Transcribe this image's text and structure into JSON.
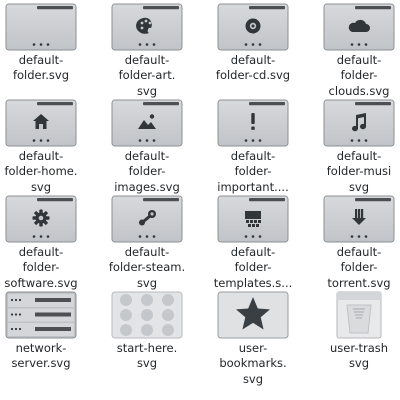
{
  "colors": {
    "folder_body": "#c3c6ca",
    "folder_border": "#8c8f93",
    "folder_tab": "#4d4f52",
    "folder_symbol": "#31363b",
    "folder_dots": "#31363b",
    "label_text": "#232629",
    "background": "#ffffff"
  },
  "files": [
    {
      "name": "default-folder.svg",
      "icon": "folder-plain-icon",
      "lines": [
        "default-",
        "folder.svg"
      ]
    },
    {
      "name": "default-folder-art.svg",
      "icon": "folder-art-icon",
      "lines": [
        "default-",
        "folder-art.",
        "svg"
      ]
    },
    {
      "name": "default-folder-cd.svg",
      "icon": "folder-cd-icon",
      "lines": [
        "default-",
        "folder-cd.svg"
      ]
    },
    {
      "name": "default-folder-clouds.svg",
      "icon": "folder-clouds-icon",
      "lines": [
        "default-",
        "folder-",
        "clouds.svg"
      ]
    },
    {
      "name": "default-folder-home.svg",
      "icon": "folder-home-icon",
      "lines": [
        "default-",
        "folder-home.",
        "svg"
      ]
    },
    {
      "name": "default-folder-images.svg",
      "icon": "folder-images-icon",
      "lines": [
        "default-",
        "folder-",
        "images.svg"
      ]
    },
    {
      "name": "default-folder-important....",
      "icon": "folder-important-icon",
      "lines": [
        "default-",
        "folder-",
        "important...."
      ]
    },
    {
      "name": "default-folder-music.svg",
      "icon": "folder-music-icon",
      "lines": [
        "default-",
        "folder-musi",
        "svg"
      ]
    },
    {
      "name": "default-folder-software.svg",
      "icon": "folder-software-icon",
      "lines": [
        "default-",
        "folder-",
        "software.svg"
      ]
    },
    {
      "name": "default-folder-steam.svg",
      "icon": "folder-steam-icon",
      "lines": [
        "default-",
        "folder-steam.",
        "svg"
      ]
    },
    {
      "name": "default-folder-templates.s...",
      "icon": "folder-templates-icon",
      "lines": [
        "default-",
        "folder-",
        "templates.s..."
      ]
    },
    {
      "name": "default-folder-torrent.svg",
      "icon": "folder-torrent-icon",
      "lines": [
        "default-",
        "folder-",
        "torrent.svg"
      ]
    },
    {
      "name": "network-server.svg",
      "icon": "network-server-icon",
      "lines": [
        "network-",
        "server.svg"
      ]
    },
    {
      "name": "start-here.svg",
      "icon": "start-here-icon",
      "lines": [
        "start-here.",
        "svg"
      ]
    },
    {
      "name": "user-bookmarks.svg",
      "icon": "user-bookmarks-icon",
      "lines": [
        "user-",
        "bookmarks.",
        "svg"
      ]
    },
    {
      "name": "user-trash.svg",
      "icon": "user-trash-icon",
      "lines": [
        "user-trash",
        "svg"
      ]
    }
  ]
}
